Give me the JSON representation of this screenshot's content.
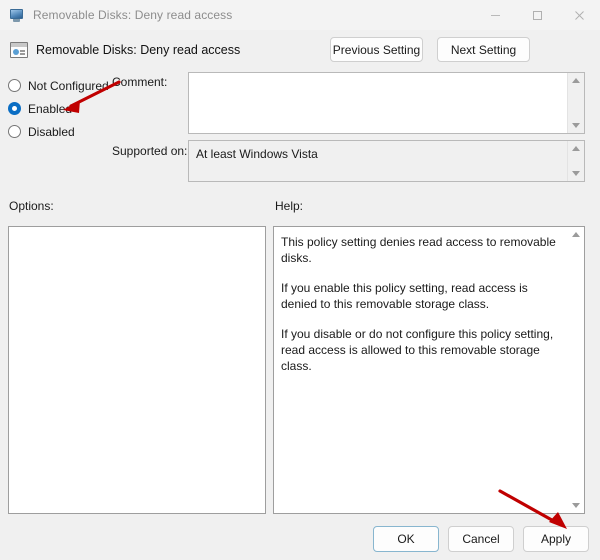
{
  "window": {
    "title": "Removable Disks: Deny read access",
    "icon": "monitor-icon",
    "controls": {
      "minimize": "minimize-icon",
      "maximize": "maximize-icon",
      "close": "close-icon"
    }
  },
  "header": {
    "policy_icon": "policy-setting-icon",
    "policy_title": "Removable Disks: Deny read access",
    "previous_setting": "Previous Setting",
    "next_setting": "Next Setting"
  },
  "state": {
    "options": [
      {
        "label": "Not Configured",
        "selected": false
      },
      {
        "label": "Enabled",
        "selected": true
      },
      {
        "label": "Disabled",
        "selected": false
      }
    ]
  },
  "comment": {
    "label": "Comment:",
    "value": ""
  },
  "supported": {
    "label": "Supported on:",
    "value": "At least Windows Vista"
  },
  "panels": {
    "options_label": "Options:",
    "options_content": "",
    "help_label": "Help:",
    "help_paragraphs": [
      "This policy setting denies read access to removable disks.",
      "If you enable this policy setting, read access is denied to this removable storage class.",
      "If you disable or do not configure this policy setting, read access is allowed to this removable storage class."
    ]
  },
  "footer": {
    "ok": "OK",
    "cancel": "Cancel",
    "apply": "Apply"
  },
  "annotations": {
    "accent_color": "#c00000",
    "arrow_to_enabled": "red-arrow-icon",
    "arrow_to_apply": "red-arrow-icon"
  }
}
